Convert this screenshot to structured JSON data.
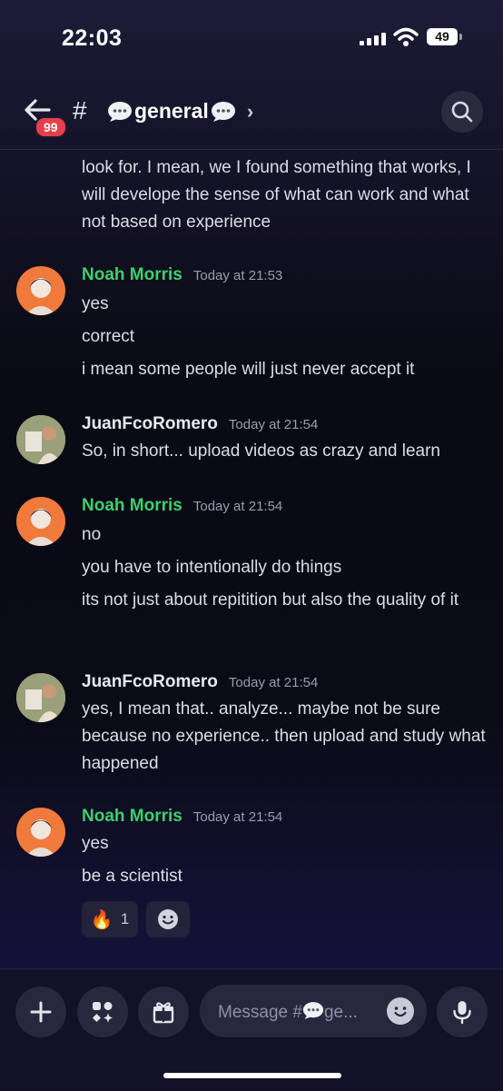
{
  "status": {
    "time": "22:03",
    "battery": "49"
  },
  "header": {
    "unread_badge": "99",
    "hash": "#",
    "channel_name": "general",
    "chevron": "›"
  },
  "messages": {
    "continuation": "look for. I mean, we I found something that works, I will develope the sense of what can work and what not based on experience",
    "groups": [
      {
        "author": "Noah Morris",
        "timestamp": "Today at 21:53",
        "lines": [
          "yes",
          "correct",
          "i mean some people will just never accept it"
        ]
      },
      {
        "author": "JuanFcoRomero",
        "timestamp": "Today at 21:54",
        "lines": [
          "So, in short... upload videos as crazy and learn"
        ]
      },
      {
        "author": "Noah Morris",
        "timestamp": "Today at 21:54",
        "lines": [
          "no",
          "you have to intentionally do things",
          "its not just about repitition but also the quality of it"
        ]
      },
      {
        "author": "JuanFcoRomero",
        "timestamp": "Today at 21:54",
        "lines": [
          "yes, I mean that.. analyze... maybe not be sure because no experience.. then upload and study what happened"
        ]
      },
      {
        "author": "Noah Morris",
        "timestamp": "Today at 21:54",
        "lines": [
          "yes",
          "be a scientist"
        ]
      }
    ],
    "reaction": {
      "emoji": "🔥",
      "count": "1"
    }
  },
  "composer": {
    "placeholder_prefix": "Message #",
    "placeholder_suffix": "ge..."
  },
  "colors": {
    "noah_name": "#3ecf6e",
    "juan_name": "#e8e8ee",
    "badge": "#e5404a",
    "noah_avatar_bg": "#f07a3c"
  },
  "icons": [
    "back-arrow-icon",
    "speech-bubble-icon",
    "search-icon",
    "plus-icon",
    "apps-icon",
    "gift-icon",
    "emoji-icon",
    "microphone-icon",
    "add-reaction-icon"
  ]
}
